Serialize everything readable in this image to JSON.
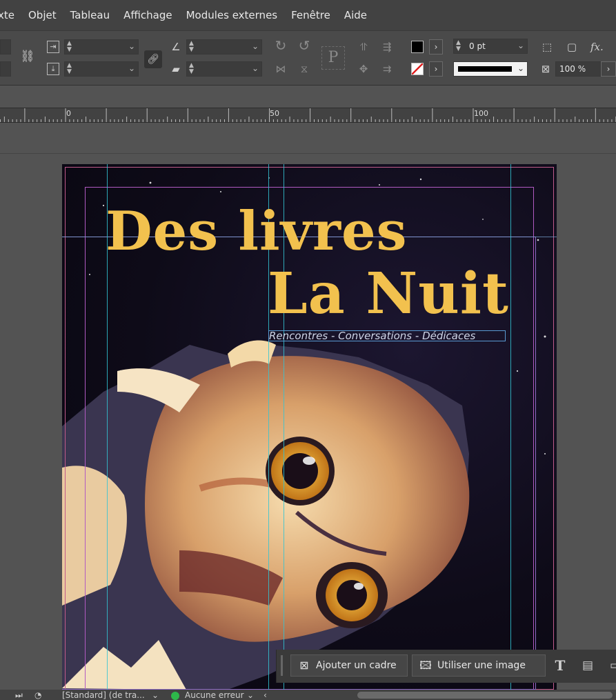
{
  "menu": [
    "xte",
    "Objet",
    "Tableau",
    "Affichage",
    "Modules externes",
    "Fenêtre",
    "Aide"
  ],
  "control": {
    "stroke_weight": "0 pt",
    "opacity": "100 %",
    "fill_color": "#000000",
    "stroke_color": "none",
    "ref_point_label": "P",
    "fx_label": "fx."
  },
  "ruler": {
    "labels": [
      "0",
      "50",
      "100"
    ]
  },
  "document": {
    "title_line1": "Des livres",
    "title_line2": "La Nuit",
    "subtitle": "Rencontres - Conversations - Dédicaces",
    "title_color": "#f2c14e"
  },
  "context_bar": {
    "add_frame_label": "Ajouter un cadre",
    "use_image_label": "Utiliser une image"
  },
  "status": {
    "style": "[Standard] (de tra...",
    "preflight": "Aucune erreur",
    "preflight_color": "#2db84a"
  }
}
